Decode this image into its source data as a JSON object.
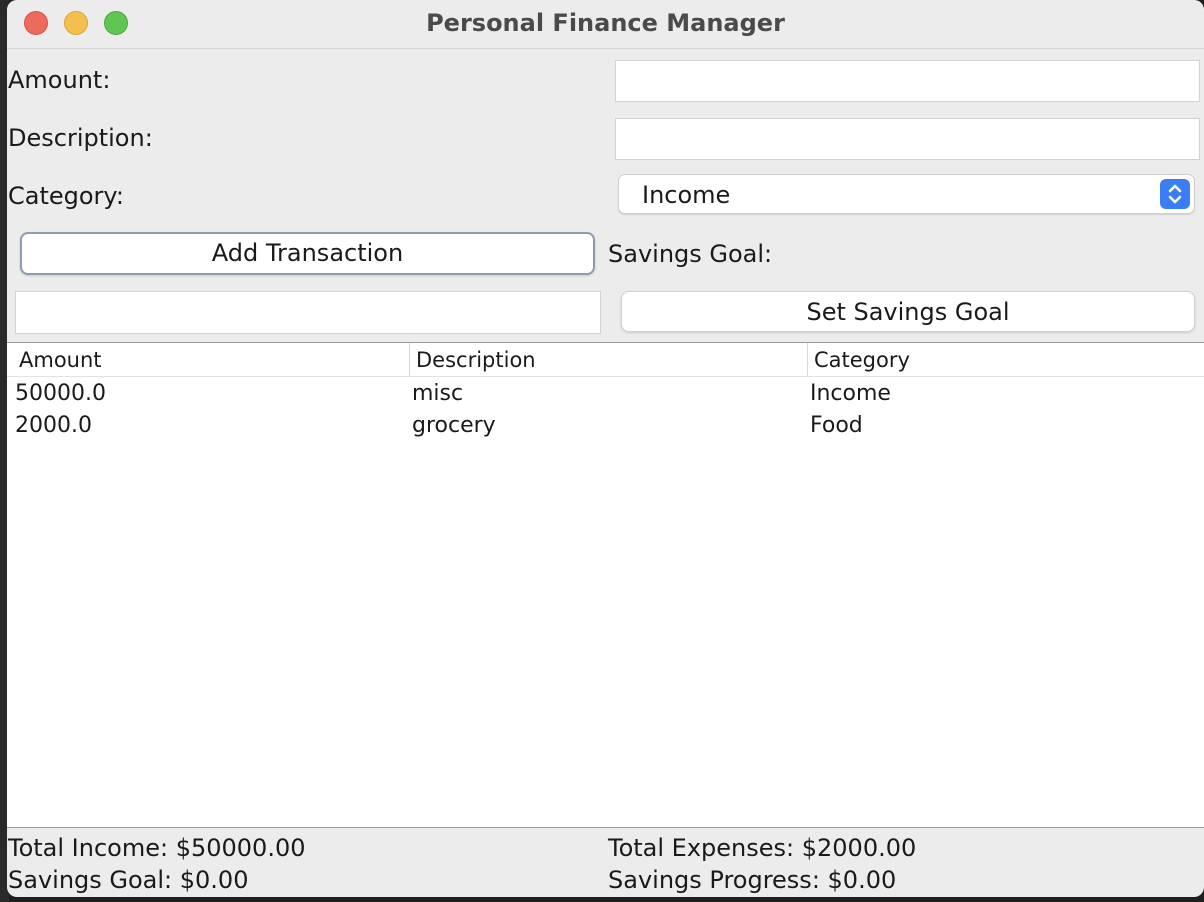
{
  "window": {
    "title": "Personal Finance Manager"
  },
  "form": {
    "amount_label": "Amount:",
    "amount_value": "",
    "description_label": "Description:",
    "description_value": "",
    "category_label": "Category:",
    "category_selected": "Income",
    "add_button_label": "Add Transaction",
    "savings_goal_label": "Savings Goal:",
    "savings_goal_value": "",
    "set_goal_button_label": "Set Savings Goal"
  },
  "table": {
    "columns": [
      "Amount",
      "Description",
      "Category"
    ],
    "rows": [
      [
        "50000.0",
        "misc",
        "Income"
      ],
      [
        "2000.0",
        "grocery",
        "Food"
      ]
    ]
  },
  "summary": {
    "total_income": "Total Income: $50000.00",
    "total_expenses": "Total Expenses: $2000.00",
    "savings_goal": "Savings Goal: $0.00",
    "savings_progress": "Savings Progress: $0.00"
  },
  "colors": {
    "accent": "#3b7df4",
    "close": "#ec6a5e",
    "minimize": "#f4bf4f",
    "maximize": "#61c554"
  },
  "icons": {
    "combo_arrows": "up-down-chevron-icon"
  }
}
